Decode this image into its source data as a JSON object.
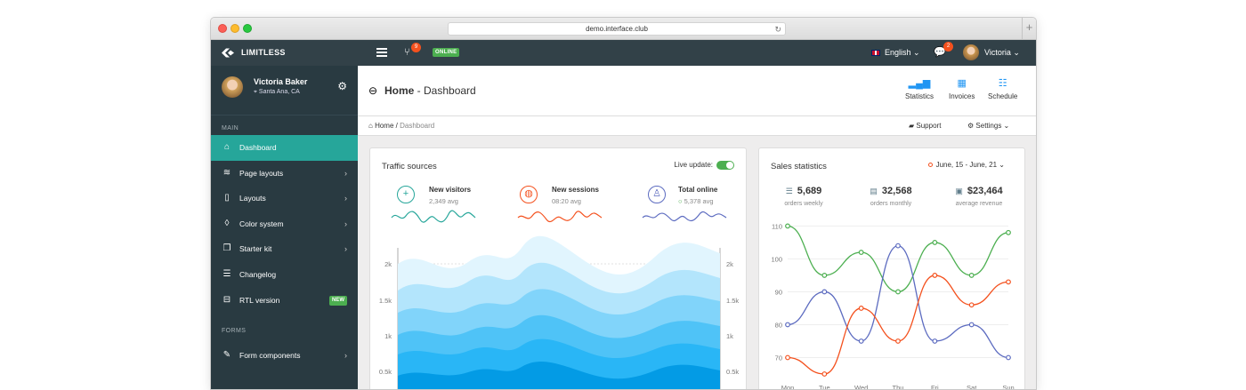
{
  "browser": {
    "url": "demo.interface.club"
  },
  "navbar": {
    "brand": "LIMITLESS",
    "git_count": "9",
    "status": "ONLINE",
    "language": "English",
    "messages_count": "2",
    "user": "Victoria"
  },
  "sidebar": {
    "user_name": "Victoria Baker",
    "user_location": "Santa Ana, CA",
    "main_heading": "MAIN",
    "items": [
      {
        "label": "Dashboard",
        "icon": "home-icon"
      },
      {
        "label": "Page layouts",
        "icon": "stack-icon"
      },
      {
        "label": "Layouts",
        "icon": "copy-icon"
      },
      {
        "label": "Color system",
        "icon": "droplet-icon"
      },
      {
        "label": "Starter kit",
        "icon": "files-icon"
      },
      {
        "label": "Changelog",
        "icon": "list-icon"
      },
      {
        "label": "RTL version",
        "icon": "width-icon",
        "badge": "NEW"
      }
    ],
    "forms_heading": "FORMS",
    "forms_items": [
      {
        "label": "Form components",
        "icon": "pencil-icon"
      }
    ]
  },
  "page_header": {
    "title": "Home",
    "subtitle": "Dashboard",
    "buttons": [
      "Statistics",
      "Invoices",
      "Schedule"
    ]
  },
  "breadcrumb": {
    "home": "Home",
    "current": "Dashboard",
    "support": "Support",
    "settings": "Settings"
  },
  "traffic": {
    "title": "Traffic sources",
    "live_label": "Live update:",
    "stats": [
      {
        "label": "New visitors",
        "value": "2,349 avg",
        "color": "#26a69a"
      },
      {
        "label": "New sessions",
        "value": "08:20 avg",
        "color": "#f4511e"
      },
      {
        "label": "Total online",
        "value": "5,378 avg",
        "color": "#5c6bc0"
      }
    ],
    "y_ticks": [
      "2k",
      "1.5k",
      "1k",
      "0.5k"
    ]
  },
  "sales": {
    "title": "Sales statistics",
    "date_range": "June, 15 - June, 21",
    "stats": [
      {
        "value": "5,689",
        "label": "orders weekly"
      },
      {
        "value": "32,568",
        "label": "orders monthly"
      },
      {
        "value": "$23,464",
        "label": "average revenue"
      }
    ]
  },
  "chart_data": {
    "type": "line",
    "categories": [
      "Mon",
      "Tue",
      "Wed",
      "Thu",
      "Fri",
      "Sat",
      "Sun"
    ],
    "ylim": [
      65,
      112
    ],
    "y_ticks": [
      70,
      80,
      90,
      100,
      110
    ],
    "series": [
      {
        "color": "#4caf50",
        "values": [
          110,
          95,
          102,
          90,
          105,
          95,
          108
        ]
      },
      {
        "color": "#5c6bc0",
        "values": [
          80,
          90,
          75,
          104,
          75,
          80,
          70
        ]
      },
      {
        "color": "#f4511e",
        "values": [
          70,
          65,
          85,
          75,
          95,
          86,
          93
        ]
      }
    ]
  }
}
